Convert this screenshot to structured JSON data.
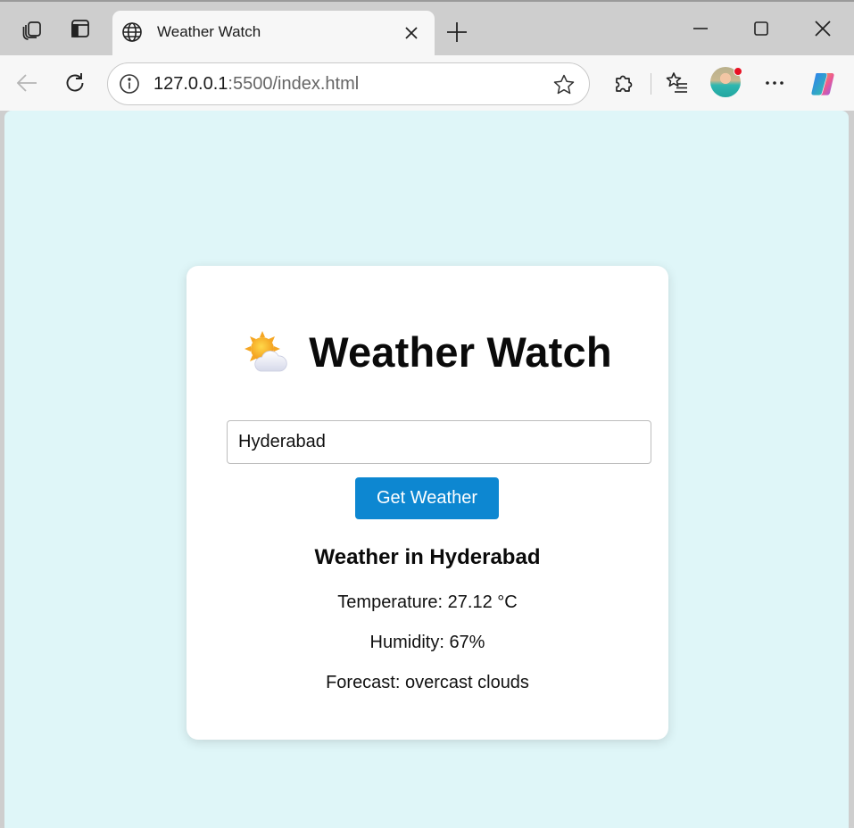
{
  "browser": {
    "tab": {
      "title": "Weather Watch"
    },
    "address": {
      "host": "127.0.0.1",
      "rest": ":5500/index.html"
    },
    "icons": {
      "workspaces": "workspaces-icon",
      "vertical_tabs": "vertical-tabs-icon",
      "site": "globe-icon",
      "close_tab": "close-icon",
      "new_tab": "plus-icon",
      "minimize": "minimize-icon",
      "maximize": "maximize-icon",
      "close_window": "close-icon",
      "back": "back-arrow-icon",
      "refresh": "refresh-icon",
      "site_info": "info-icon",
      "favorite": "star-icon",
      "extensions": "puzzle-icon",
      "favorites": "favorites-list-icon",
      "profile": "avatar",
      "more": "ellipsis-icon",
      "copilot": "copilot-icon"
    }
  },
  "app": {
    "heading": "Weather Watch",
    "heading_icon": "sun-behind-cloud-icon",
    "search": {
      "value": "Hyderabad",
      "placeholder": ""
    },
    "button_label": "Get Weather",
    "result": {
      "title": "Weather in Hyderabad",
      "temperature": "Temperature: 27.12 °C",
      "humidity": "Humidity: 67%",
      "forecast": "Forecast: overcast clouds"
    }
  },
  "colors": {
    "page_background": "#dff6f8",
    "card_background": "#ffffff",
    "button_background": "#0d87d1",
    "button_text": "#ffffff",
    "profile_notification": "#e81123"
  }
}
